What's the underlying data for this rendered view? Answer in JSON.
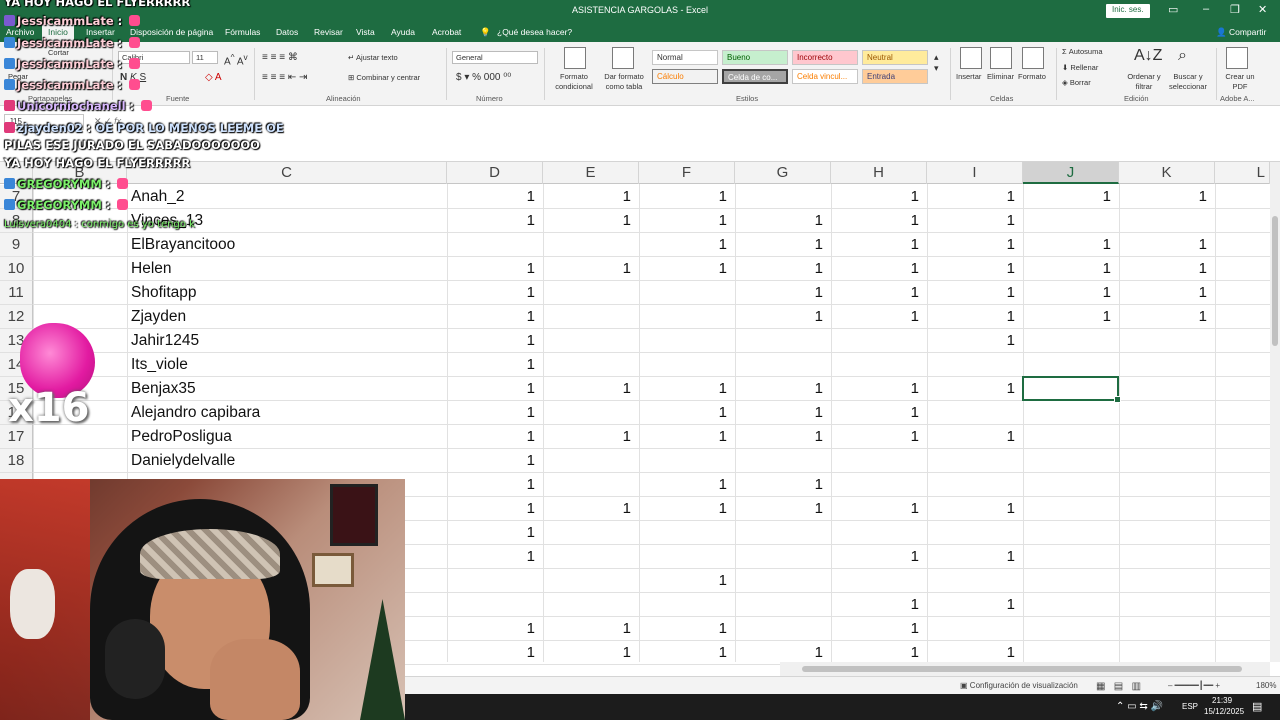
{
  "window": {
    "title": "ASISTENCIA GARGOLAS  -  Excel",
    "signin_label": "Inic. ses.",
    "share_label": "Compartir"
  },
  "tabs": [
    "Archivo",
    "Inicio",
    "Insertar",
    "Disposición de página",
    "Fórmulas",
    "Datos",
    "Revisar",
    "Vista",
    "Ayuda",
    "Acrobat"
  ],
  "tell_me": "¿Qué desea hacer?",
  "ribbon": {
    "clipboard": {
      "cut": "Cortar",
      "paste": "Pegar",
      "group": "Portapapeles"
    },
    "font": {
      "name": "Calibri",
      "size": "11",
      "group": "Fuente"
    },
    "alignment": {
      "wrap": "Ajustar texto",
      "merge": "Combinar y centrar",
      "group": "Alineación"
    },
    "number": {
      "format": "General",
      "group": "Número"
    },
    "styles": {
      "conditional": "Formato condicional",
      "as_table": "Dar formato como tabla",
      "cells": [
        "Normal",
        "Bueno",
        "Incorrecto",
        "Neutral",
        "Cálculo",
        "Celda de co...",
        "Celda vincul...",
        "Entrada"
      ],
      "group": "Estilos"
    },
    "cells": {
      "insert": "Insertar",
      "delete": "Eliminar",
      "format": "Formato",
      "group": "Celdas"
    },
    "editing": {
      "autosum": "Autosuma",
      "fill": "Rellenar",
      "clear": "Borrar",
      "sort": "Ordenar y filtrar",
      "find": "Buscar y seleccionar",
      "group": "Edición"
    },
    "adobe": {
      "create_pdf": "Crear un PDF",
      "group": "Adobe A..."
    }
  },
  "formula_bar": {
    "name_box": "J15"
  },
  "grid": {
    "columns": [
      "B",
      "C",
      "D",
      "E",
      "F",
      "G",
      "H",
      "I",
      "J",
      "K",
      "L"
    ],
    "selected_column": "J",
    "rows": [
      {
        "num": "7",
        "name": "Anah_2",
        "values": [
          "1",
          "1",
          "1",
          "",
          "1",
          "1",
          "1",
          "1"
        ]
      },
      {
        "num": "8",
        "name": "Vinces_13",
        "values": [
          "1",
          "1",
          "1",
          "1",
          "1",
          "1",
          "",
          ""
        ]
      },
      {
        "num": "9",
        "name": "ElBrayancitooo",
        "values": [
          "",
          "",
          "1",
          "1",
          "1",
          "1",
          "1",
          "1"
        ]
      },
      {
        "num": "10",
        "name": "Helen",
        "values": [
          "1",
          "1",
          "1",
          "1",
          "1",
          "1",
          "1",
          "1"
        ]
      },
      {
        "num": "11",
        "name": "Shofitapp",
        "values": [
          "1",
          "",
          "",
          "1",
          "1",
          "1",
          "1",
          "1"
        ]
      },
      {
        "num": "12",
        "name": "Zjayden",
        "values": [
          "1",
          "",
          "",
          "1",
          "1",
          "1",
          "1",
          "1"
        ]
      },
      {
        "num": "13",
        "name": "Jahir1245",
        "values": [
          "1",
          "",
          "",
          "",
          "",
          "1",
          "",
          ""
        ]
      },
      {
        "num": "14",
        "name": "Its_viole",
        "values": [
          "1",
          "",
          "",
          "",
          "",
          "",
          "",
          ""
        ]
      },
      {
        "num": "15",
        "name": "Benjax35",
        "values": [
          "1",
          "1",
          "1",
          "1",
          "1",
          "1",
          "",
          ""
        ]
      },
      {
        "num": "16",
        "name": "Alejandro capibara",
        "values": [
          "1",
          "",
          "1",
          "1",
          "1",
          "",
          "",
          ""
        ]
      },
      {
        "num": "17",
        "name": "PedroPosligua",
        "values": [
          "1",
          "1",
          "1",
          "1",
          "1",
          "1",
          "",
          ""
        ]
      },
      {
        "num": "18",
        "name": "Danielydelvalle",
        "values": [
          "1",
          "",
          "",
          "",
          "",
          "",
          "",
          ""
        ]
      },
      {
        "num": "19",
        "name": "",
        "values": [
          "1",
          "",
          "1",
          "1",
          "",
          "",
          "",
          ""
        ]
      },
      {
        "num": "20",
        "name": "",
        "values": [
          "1",
          "1",
          "1",
          "1",
          "1",
          "1",
          "",
          ""
        ]
      },
      {
        "num": "21",
        "name": "",
        "values": [
          "1",
          "",
          "",
          "",
          "",
          "",
          "",
          ""
        ]
      },
      {
        "num": "22",
        "name": "",
        "values": [
          "1",
          "",
          "",
          "",
          "1",
          "1",
          "",
          ""
        ]
      },
      {
        "num": "23",
        "name": "",
        "values": [
          "",
          "",
          "1",
          "",
          "",
          "",
          "",
          ""
        ]
      },
      {
        "num": "24",
        "name": "",
        "values": [
          "",
          "",
          "",
          "",
          "1",
          "1",
          "",
          ""
        ]
      },
      {
        "num": "25",
        "name": "",
        "values": [
          "1",
          "1",
          "1",
          "",
          "1",
          "",
          "",
          ""
        ]
      },
      {
        "num": "26",
        "name": "",
        "values": [
          "1",
          "1",
          "1",
          "1",
          "1",
          "1",
          "",
          ""
        ]
      }
    ]
  },
  "status_bar": {
    "display_settings": "Configuración de visualización",
    "zoom": "180%"
  },
  "taskbar": {
    "lang": "ESP",
    "time": "21:39",
    "date": "15/12/2025"
  },
  "overlay": {
    "chat": [
      {
        "user": "",
        "text": "YA HOY HAGO EL FLYERRRRR",
        "color": "white"
      },
      {
        "user": "JessicammLate",
        "text": "",
        "color": "red"
      },
      {
        "user": "JessicammLate",
        "text": "",
        "color": "red"
      },
      {
        "user": "JessicammLate",
        "text": "",
        "color": "red"
      },
      {
        "user": "JessicammLate",
        "text": "",
        "color": "red"
      },
      {
        "user": "Unicorniochanell",
        "text": "",
        "color": "purple"
      },
      {
        "user": "zjayden02",
        "text": "OE POR LO MENOS LEEME OE",
        "color": "blue"
      },
      {
        "user": "",
        "text": "PILAS ESE JURADO EL SABADOOOOOOO",
        "color": "white"
      },
      {
        "user": "",
        "text": "YA HOY HAGO EL FLYERRRRR",
        "color": "white"
      },
      {
        "user": "GREGORYMM",
        "text": "",
        "color": "green"
      },
      {
        "user": "GREGORYMM",
        "text": "",
        "color": "green"
      },
      {
        "user": "Luisvera0404",
        "text": "conmigo es yo tengo k",
        "color": "green"
      }
    ],
    "reaction_count": "x16"
  }
}
